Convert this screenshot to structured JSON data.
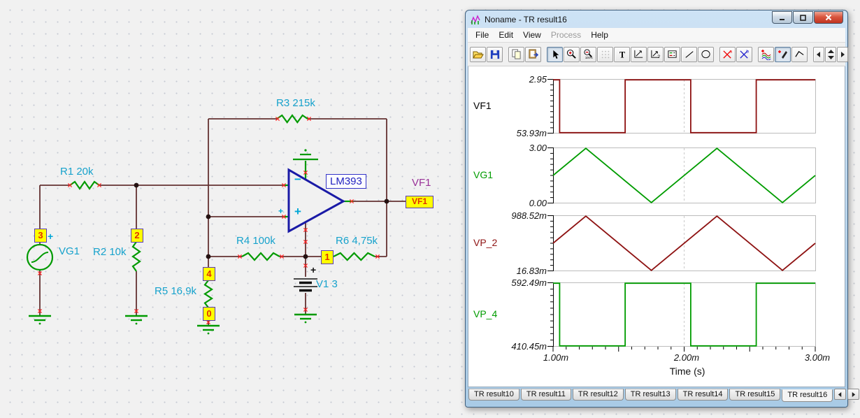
{
  "schematic": {
    "labels": {
      "r1": "R1 20k",
      "r2": "R2 10k",
      "r3": "R3 215k",
      "r4": "R4 100k",
      "r5": "R5 16,9k",
      "r6": "R6 4,75k",
      "v1": "V1 3",
      "vg1": "VG1",
      "opamp": "LM393",
      "output_net": "VF1",
      "output_pin": "VF1"
    },
    "node_numbers": {
      "n0": "0",
      "n1": "1",
      "n2": "2",
      "n3": "3",
      "n4": "4"
    },
    "symbols": {
      "plus": "+",
      "minus": "−"
    },
    "colors": {
      "wire": "#643232",
      "component": "#009a00",
      "label": "#17a2cc",
      "net_label": "#993399",
      "node_box": "#ffff00",
      "pin_mark": "#ff2020"
    }
  },
  "window": {
    "title": "Noname - TR result16",
    "menu": {
      "items": [
        "File",
        "Edit",
        "View",
        "Process",
        "Help"
      ],
      "disabled_item": "Process"
    },
    "toolbar_icons": [
      "open",
      "save",
      "copy",
      "paste",
      "cursor",
      "zoom-in",
      "zoom-out",
      "grid",
      "text",
      "set-scale",
      "auto-scale",
      "legend",
      "line",
      "ellipse",
      "cursor-a",
      "cursor-b",
      "add-curves",
      "probe",
      "polyline",
      "page-left",
      "page-spinner",
      "page-right"
    ],
    "tabs": {
      "items": [
        "TR result10",
        "TR result11",
        "TR result12",
        "TR result13",
        "TR result14",
        "TR result15",
        "TR result16"
      ],
      "active": "TR result16"
    }
  },
  "chart_data": {
    "type": "line",
    "xlabel": "Time (s)",
    "xlim_ms": [
      1,
      3
    ],
    "x_ticks": [
      "1.00m",
      "2.00m",
      "3.00m"
    ],
    "x_minor_tick_step_ms": 0.1,
    "cursor_time_ms": 2,
    "grid": "off",
    "charts": [
      {
        "name": "VF1",
        "color": "#8e1212",
        "label_color": "#000000",
        "ymax": 2.95,
        "ymin": 0.05393,
        "ymax_label": "2.95",
        "ymin_label": "53.93m",
        "points_ms_v": [
          [
            1,
            2.95
          ],
          [
            1.05,
            2.95
          ],
          [
            1.05,
            0.05393
          ],
          [
            1.55,
            0.05393
          ],
          [
            1.55,
            2.95
          ],
          [
            2.05,
            2.95
          ],
          [
            2.05,
            0.05393
          ],
          [
            2.55,
            0.05393
          ],
          [
            2.55,
            2.95
          ],
          [
            3,
            2.95
          ]
        ]
      },
      {
        "name": "VG1",
        "color": "#009c00",
        "label_color": "#009c00",
        "ymax": 3.0,
        "ymin": 0.0,
        "ymax_label": "3.00",
        "ymin_label": "0.00",
        "points_ms_v": [
          [
            1,
            1.5
          ],
          [
            1.25,
            3
          ],
          [
            1.75,
            0
          ],
          [
            2.25,
            3
          ],
          [
            2.75,
            0
          ],
          [
            3,
            1.5
          ]
        ]
      },
      {
        "name": "VP_2",
        "color": "#8e1212",
        "label_color": "#8e1212",
        "ymax": 0.98852,
        "ymin": 0.01683,
        "ymax_label": "988.52m",
        "ymin_label": "16.83m",
        "points_ms_v": [
          [
            1,
            0.503
          ],
          [
            1.25,
            0.98852
          ],
          [
            1.75,
            0.01683
          ],
          [
            2.25,
            0.98852
          ],
          [
            2.75,
            0.01683
          ],
          [
            3,
            0.503
          ]
        ]
      },
      {
        "name": "VP_4",
        "color": "#009c00",
        "label_color": "#009c00",
        "ymax": 0.59249,
        "ymin": 0.41045,
        "ymax_label": "592.49m",
        "ymin_label": "410.45m",
        "points_ms_v": [
          [
            1,
            0.59249
          ],
          [
            1.05,
            0.59249
          ],
          [
            1.05,
            0.41045
          ],
          [
            1.55,
            0.41045
          ],
          [
            1.55,
            0.59249
          ],
          [
            2.05,
            0.59249
          ],
          [
            2.05,
            0.41045
          ],
          [
            2.55,
            0.41045
          ],
          [
            2.55,
            0.59249
          ],
          [
            3,
            0.59249
          ]
        ]
      }
    ]
  }
}
